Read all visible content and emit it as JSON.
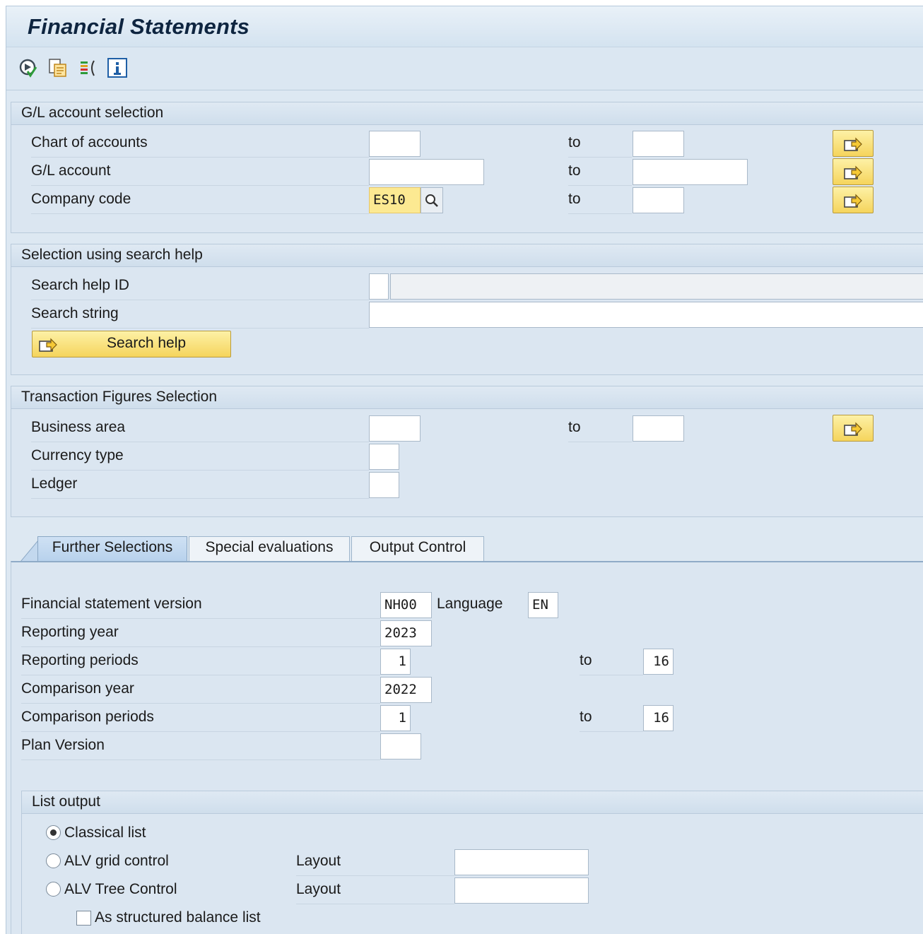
{
  "window": {
    "title": "Financial Statements"
  },
  "toolbar": {
    "icons": [
      "execute-icon",
      "get-variant-icon",
      "selection-options-icon",
      "information-icon"
    ]
  },
  "gl_selection": {
    "header": "G/L account selection",
    "chart_of_accounts": {
      "label": "Chart of accounts",
      "from": "",
      "to_label": "to",
      "to": ""
    },
    "gl_account": {
      "label": "G/L account",
      "from": "",
      "to_label": "to",
      "to": ""
    },
    "company_code": {
      "label": "Company code",
      "from": "ES10",
      "to_label": "to",
      "to": ""
    }
  },
  "search_help": {
    "header": "Selection using search help",
    "id_label": "Search help ID",
    "id_value": "",
    "id_desc": "",
    "string_label": "Search string",
    "string_value": "",
    "button_label": "Search help"
  },
  "transaction_figures": {
    "header": "Transaction Figures Selection",
    "business_area": {
      "label": "Business area",
      "from": "",
      "to_label": "to",
      "to": ""
    },
    "currency_type": {
      "label": "Currency type",
      "value": ""
    },
    "ledger": {
      "label": "Ledger",
      "value": ""
    }
  },
  "tabs": [
    {
      "label": "Further Selections",
      "active": true
    },
    {
      "label": "Special evaluations",
      "active": false
    },
    {
      "label": "Output Control",
      "active": false
    }
  ],
  "further": {
    "fs_version": {
      "label": "Financial statement version",
      "value": "NH00",
      "lang_label": "Language",
      "lang_value": "EN"
    },
    "reporting_year": {
      "label": "Reporting year",
      "value": "2023"
    },
    "reporting_periods": {
      "label": "Reporting periods",
      "from": "1",
      "to_label": "to",
      "to": "16"
    },
    "comparison_year": {
      "label": "Comparison year",
      "value": "2022"
    },
    "comparison_periods": {
      "label": "Comparison periods",
      "from": "1",
      "to_label": "to",
      "to": "16"
    },
    "plan_version": {
      "label": "Plan Version",
      "value": ""
    }
  },
  "list_output": {
    "header": "List output",
    "classical": {
      "label": "Classical list",
      "selected": true
    },
    "alv_grid": {
      "label": "ALV grid control",
      "selected": false,
      "layout_label": "Layout",
      "layout_value": ""
    },
    "alv_tree": {
      "label": "ALV Tree Control",
      "selected": false,
      "layout_label": "Layout",
      "layout_value": ""
    },
    "structured": {
      "label": "As structured balance list",
      "checked": false
    }
  }
}
